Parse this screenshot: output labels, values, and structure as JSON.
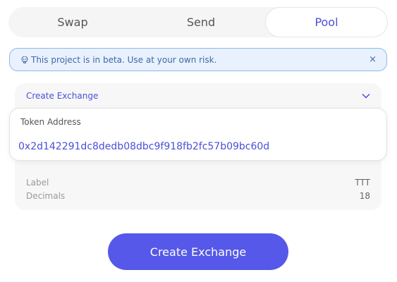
{
  "tabs": [
    {
      "label": "Swap",
      "active": false
    },
    {
      "label": "Send",
      "active": false
    },
    {
      "label": "Pool",
      "active": true
    }
  ],
  "banner": {
    "icon": "skull-icon",
    "text": "This project is in beta. Use at your own risk.",
    "close_symbol": "×"
  },
  "exchange": {
    "title": "Create Exchange",
    "token_address_label": "Token Address",
    "token_address_value": "0x2d142291dc8dedb08dbc9f918fb2fc57b09bc60d",
    "details": [
      {
        "label": "Label",
        "value": "TTT"
      },
      {
        "label": "Decimals",
        "value": "18"
      }
    ]
  },
  "actions": {
    "create_label": "Create Exchange"
  },
  "colors": {
    "accent": "#5558e8",
    "accent_text": "#4b4fd8",
    "banner_bg": "#e8f1fd",
    "banner_border": "#8fb8ee"
  }
}
